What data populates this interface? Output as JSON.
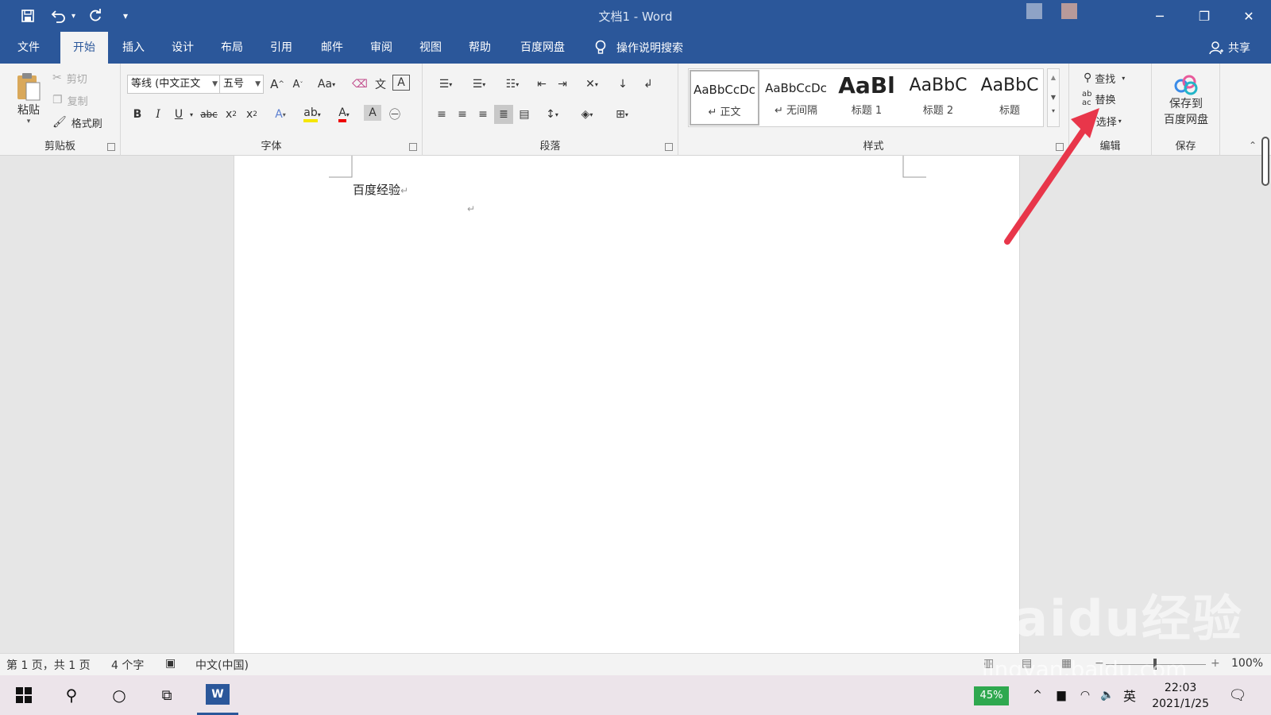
{
  "window": {
    "title": "文档1  -  Word"
  },
  "tabs": [
    {
      "label": "文件"
    },
    {
      "label": "开始"
    },
    {
      "label": "插入"
    },
    {
      "label": "设计"
    },
    {
      "label": "布局"
    },
    {
      "label": "引用"
    },
    {
      "label": "邮件"
    },
    {
      "label": "审阅"
    },
    {
      "label": "视图"
    },
    {
      "label": "帮助"
    },
    {
      "label": "百度网盘"
    }
  ],
  "tell_me": "操作说明搜索",
  "share": "共享",
  "clipboard": {
    "paste": "粘贴",
    "cut": "剪切",
    "copy": "复制",
    "format_painter": "格式刷",
    "group_label": "剪贴板"
  },
  "font": {
    "font_name": "等线 (中文正文",
    "font_size": "五号",
    "group_label": "字体"
  },
  "paragraph": {
    "group_label": "段落"
  },
  "styles": {
    "items": [
      {
        "preview": "AaBbCcDc",
        "name": "↵ 正文"
      },
      {
        "preview": "AaBbCcDc",
        "name": "↵ 无间隔"
      },
      {
        "preview": "AaBl",
        "name": "标题 1"
      },
      {
        "preview": "AaBbC",
        "name": "标题 2"
      },
      {
        "preview": "AaBbC",
        "name": "标题"
      }
    ],
    "group_label": "样式"
  },
  "editing": {
    "find": "查找",
    "replace": "替换",
    "select": "选择",
    "group_label": "编辑"
  },
  "save_group": {
    "button_line1": "保存到",
    "button_line2": "百度网盘",
    "group_label": "保存"
  },
  "document": {
    "text": "百度经验"
  },
  "status": {
    "page": "第 1 页，共 1 页",
    "words": "4 个字",
    "language": "中文(中国)",
    "zoom": "100%"
  },
  "taskbar": {
    "battery": "45%",
    "ime": "英",
    "time": "22:03",
    "date": "2021/1/25"
  },
  "watermark": {
    "logo": "Baidu经验",
    "url": "jingyan.baidu.com"
  },
  "colors": {
    "word_blue": "#2b579a",
    "annotation_arrow": "#e8364a"
  }
}
